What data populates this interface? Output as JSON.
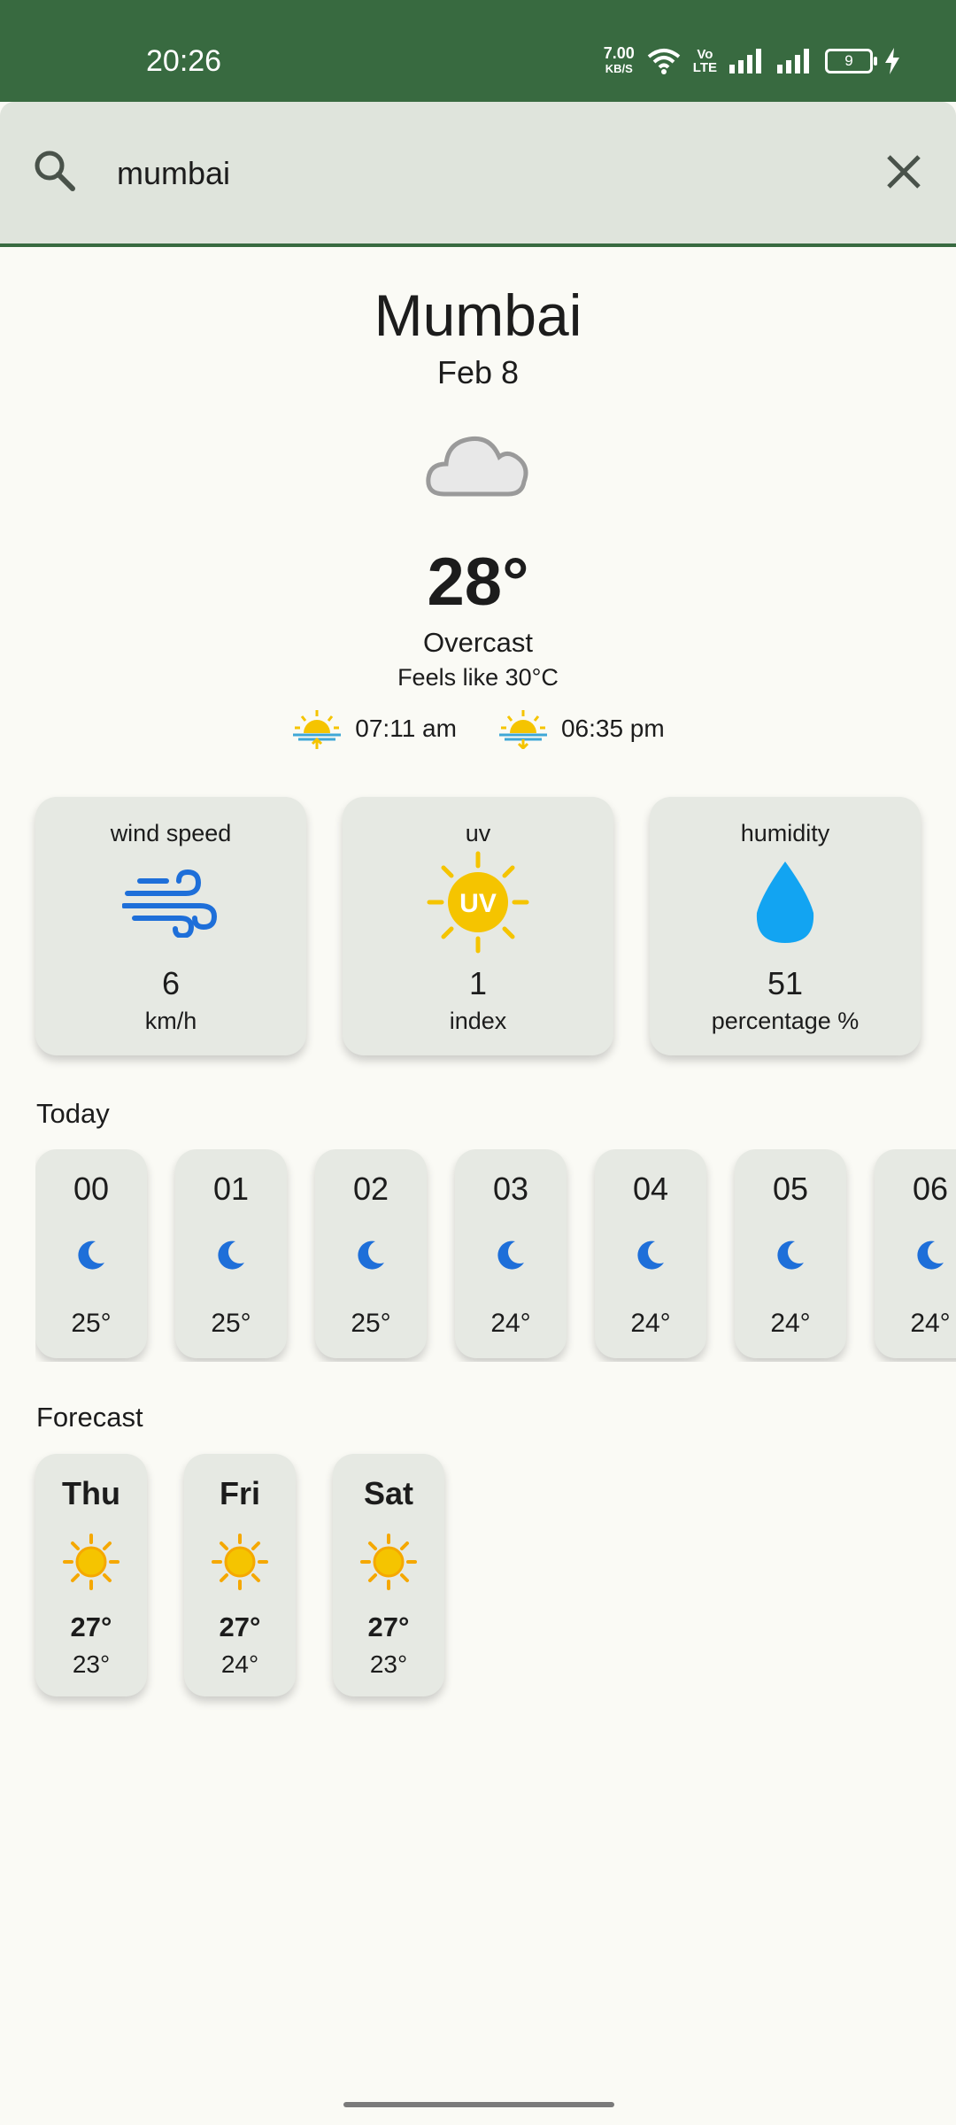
{
  "status_bar": {
    "time": "20:26",
    "net_speed_value": "7.00",
    "net_speed_unit": "KB/S",
    "volte_top": "Vo",
    "volte_bottom": "LTE",
    "battery": "9"
  },
  "search": {
    "value": "mumbai",
    "placeholder": ""
  },
  "current": {
    "city": "Mumbai",
    "date": "Feb 8",
    "icon": "cloud-icon",
    "temperature": "28°",
    "condition": "Overcast",
    "feels_like": "Feels like 30°C",
    "sunrise": "07:11 am",
    "sunset": "06:35 pm"
  },
  "stats": [
    {
      "title": "wind speed",
      "value": "6",
      "unit": "km/h",
      "icon": "wind-icon"
    },
    {
      "title": "uv",
      "value": "1",
      "unit": "index",
      "icon": "uv-sun-icon",
      "icon_text": "UV"
    },
    {
      "title": "humidity",
      "value": "51",
      "unit": "percentage %",
      "icon": "water-drop-icon"
    }
  ],
  "today": {
    "label": "Today",
    "hours": [
      {
        "hour": "00",
        "temp": "25°",
        "icon": "moon-icon"
      },
      {
        "hour": "01",
        "temp": "25°",
        "icon": "moon-icon"
      },
      {
        "hour": "02",
        "temp": "25°",
        "icon": "moon-icon"
      },
      {
        "hour": "03",
        "temp": "24°",
        "icon": "moon-icon"
      },
      {
        "hour": "04",
        "temp": "24°",
        "icon": "moon-icon"
      },
      {
        "hour": "05",
        "temp": "24°",
        "icon": "moon-icon"
      },
      {
        "hour": "06",
        "temp": "24°",
        "icon": "moon-icon"
      }
    ]
  },
  "forecast": {
    "label": "Forecast",
    "days": [
      {
        "day": "Thu",
        "max": "27°",
        "min": "23°",
        "icon": "sun-icon"
      },
      {
        "day": "Fri",
        "max": "27°",
        "min": "24°",
        "icon": "sun-icon"
      },
      {
        "day": "Sat",
        "max": "27°",
        "min": "23°",
        "icon": "sun-icon"
      }
    ]
  },
  "colors": {
    "status_bar": "#386a40",
    "background": "#fafaf5",
    "card": "#e6e9e3",
    "accent_blue": "#1e6fd9",
    "sun_yellow": "#f5c400",
    "drop_blue": "#12a4f2"
  }
}
